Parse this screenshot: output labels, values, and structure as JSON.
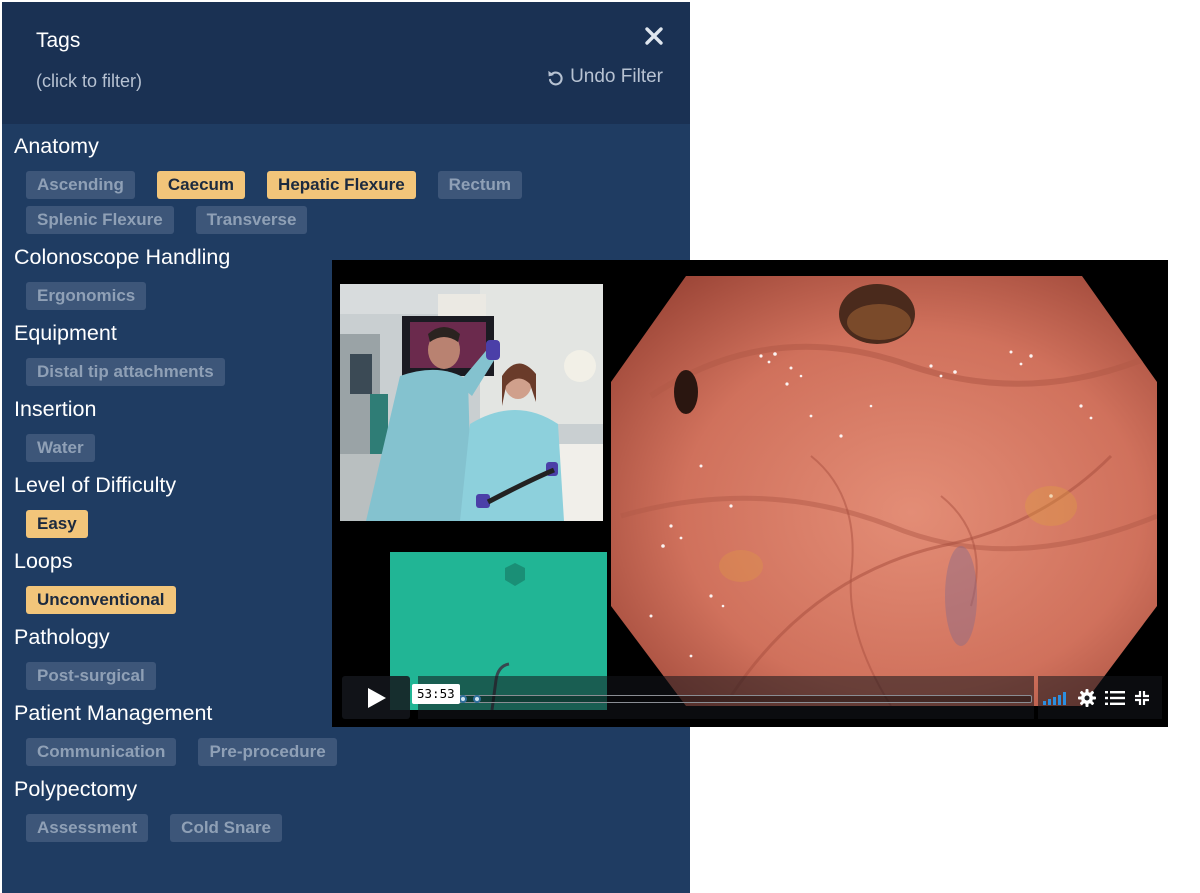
{
  "panel": {
    "title": "Tags",
    "subtitle": "(click to filter)",
    "undo_label": "Undo Filter",
    "close_icon": "close-icon",
    "undo_icon": "undo-icon"
  },
  "groups": [
    {
      "name": "Anatomy",
      "tags": [
        {
          "label": "Ascending",
          "active": false
        },
        {
          "label": "Caecum",
          "active": true
        },
        {
          "label": "Hepatic Flexure",
          "active": true
        },
        {
          "label": "Rectum",
          "active": false
        },
        {
          "label": "Splenic Flexure",
          "active": false
        },
        {
          "label": "Transverse",
          "active": false
        }
      ]
    },
    {
      "name": "Colonoscope Handling",
      "tags": [
        {
          "label": "Ergonomics",
          "active": false
        }
      ]
    },
    {
      "name": "Equipment",
      "tags": [
        {
          "label": "Distal tip attachments",
          "active": false
        }
      ]
    },
    {
      "name": "Insertion",
      "tags": [
        {
          "label": "Water",
          "active": false
        }
      ]
    },
    {
      "name": "Level of Difficulty",
      "tags": [
        {
          "label": "Easy",
          "active": true
        }
      ]
    },
    {
      "name": "Loops",
      "tags": [
        {
          "label": "Unconventional",
          "active": true
        }
      ]
    },
    {
      "name": "Pathology",
      "tags": [
        {
          "label": "Post-surgical",
          "active": false
        }
      ]
    },
    {
      "name": "Patient Management",
      "tags": [
        {
          "label": "Communication",
          "active": false
        },
        {
          "label": "Pre-procedure",
          "active": false
        }
      ]
    },
    {
      "name": "Polypectomy",
      "tags": [
        {
          "label": "Assessment",
          "active": false
        },
        {
          "label": "Cold Snare",
          "active": false
        }
      ]
    }
  ],
  "player": {
    "time_display": "53:53",
    "play_icon": "play-icon",
    "volume_icon": "volume-icon",
    "settings_icon": "gear-icon",
    "chapters_icon": "list-icon",
    "fullscreen_icon": "fullscreen-icon",
    "markers": [
      "chapter-marker",
      "chapter-marker",
      "chapter-marker"
    ]
  },
  "colors": {
    "panel_bg": "#1f3c62",
    "header_bg": "#1a3153",
    "tag_bg": "#3d5679",
    "tag_text": "#8fa0b6",
    "tag_active_bg": "#f2c57a",
    "tag_active_text": "#1c2a3f",
    "map_bg": "#21b595"
  }
}
